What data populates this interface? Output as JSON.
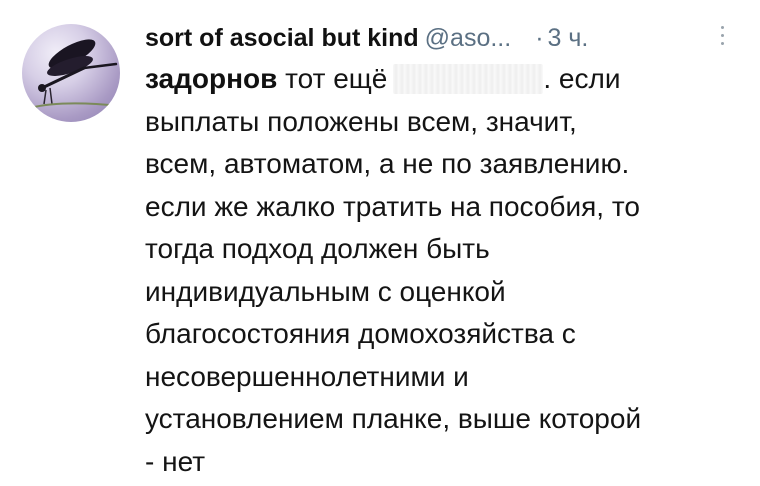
{
  "tweet": {
    "display_name": "sort of asocial but kind",
    "handle": "@aso...",
    "dot": "·",
    "time": "3 ч.",
    "mention": "задорнов",
    "line1_before": " тот ещё",
    "line1_after": ". если",
    "lines": [
      "выплаты положены всем, значит,",
      "всем, автоматом, а не по заявлению.",
      "если же жалко тратить на пособия, то",
      "тогда подход должен быть",
      "индивидуальным с оценкой",
      "благосостояния домохозяйства с",
      "несовершеннолетними и",
      "установлением планке, выше которой",
      "- нет"
    ]
  },
  "colors": {
    "text": "#141414",
    "secondary": "#5b7083",
    "background": "#ffffff"
  },
  "icons": {
    "avatar": "dragonfly-avatar",
    "more": "more-options-icon"
  }
}
